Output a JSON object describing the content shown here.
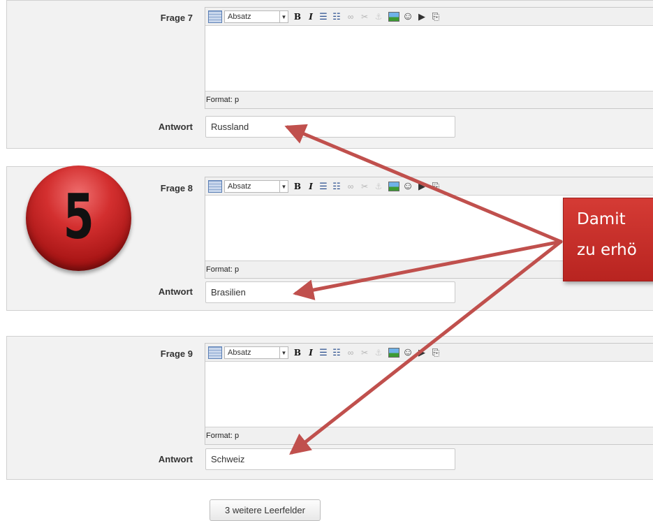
{
  "questions": [
    {
      "label": "Frage 7",
      "format_option": "Absatz",
      "status": "Format: p",
      "answer_label": "Antwort",
      "answer_value": "Russland"
    },
    {
      "label": "Frage 8",
      "format_option": "Absatz",
      "status": "Format: p",
      "answer_label": "Antwort",
      "answer_value": "Brasilien"
    },
    {
      "label": "Frage 9",
      "format_option": "Absatz",
      "status": "Format: p",
      "answer_label": "Antwort",
      "answer_value": "Schweiz"
    }
  ],
  "toolbar_icons": [
    "toolbar-toggle-icon",
    "bold-icon",
    "italic-icon",
    "bullet-list-icon",
    "numbered-list-icon",
    "link-icon",
    "unlink-icon",
    "anchor-icon",
    "image-icon",
    "emoticon-icon",
    "media-icon",
    "paste-icon"
  ],
  "toolbar_glyphs": {
    "bold": "B",
    "italic": "I",
    "ul": "☰",
    "ol": "☷",
    "link": "∞",
    "unlink": "✂",
    "anchor": "⚓",
    "emoji": "☺",
    "media": "▶",
    "paste": "⎘",
    "dropdown": "▼",
    "resize": "◢"
  },
  "more_fields_button": "3 weitere Leerfelder",
  "step_badge": "5",
  "callout": {
    "line1": "Damit",
    "line2": "zu erhö"
  },
  "colors": {
    "callout": "#c0302b",
    "badge": "#c62828",
    "arrow": "#c0504d",
    "fieldset_bg": "#f2f2f2"
  }
}
